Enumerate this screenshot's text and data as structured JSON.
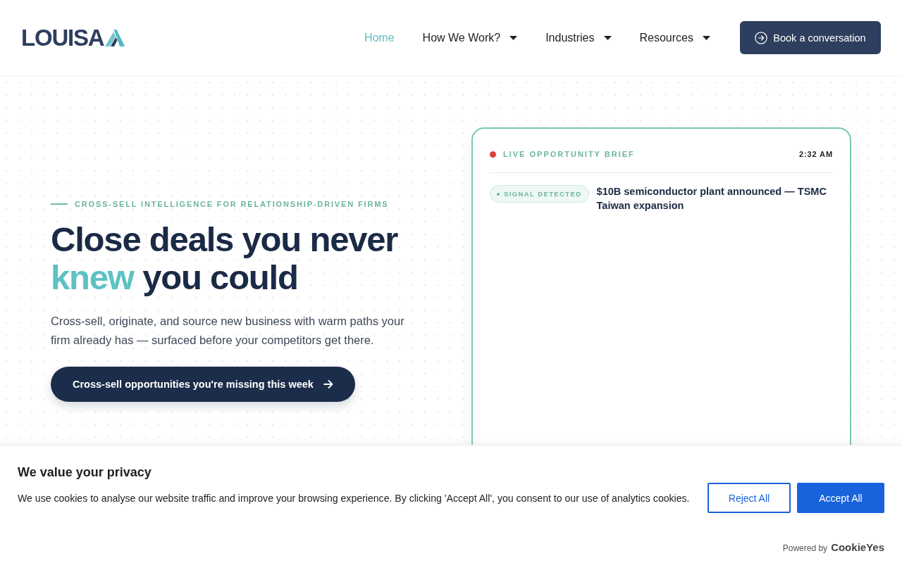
{
  "header": {
    "logo": {
      "text": "LOUISA"
    },
    "nav": [
      {
        "label": "Home",
        "selected": true,
        "dropdown": false
      },
      {
        "label": "How We Work?",
        "selected": false,
        "dropdown": true
      },
      {
        "label": "Industries",
        "selected": false,
        "dropdown": true
      },
      {
        "label": "Resources",
        "selected": false,
        "dropdown": true
      }
    ],
    "cta": {
      "label": "Book a conversation"
    }
  },
  "hero": {
    "eyebrow": "CROSS-SELL INTELLIGENCE FOR RELATIONSHIP-DRIVEN FIRMS",
    "heading": [
      {
        "text": "Close deals you never ",
        "highlight": false
      },
      {
        "text": "knew",
        "highlight": true
      },
      {
        "text": " you could",
        "highlight": false
      }
    ],
    "description": "Cross-sell, originate, and source new business with warm paths your firm already has — surfaced before your competitors get there.",
    "cta": {
      "label": "Cross-sell opportunities you're missing this week"
    }
  },
  "brief_card": {
    "live": true,
    "title": "LIVE OPPORTUNITY BRIEF",
    "time": "2:32 AM",
    "signals": [
      {
        "badge": "SIGNAL DETECTED",
        "headline": "$10B semiconductor plant announced — TSMC Taiwan expansion"
      }
    ]
  },
  "cookie_banner": {
    "title": "We value your privacy",
    "text": "We use cookies to analyse our website traffic and improve your browsing experience. By clicking 'Accept All', you consent to our use of analytics cookies.",
    "buttons": [
      {
        "label": "Reject All",
        "kind": "secondary"
      },
      {
        "label": "Accept All",
        "kind": "primary"
      }
    ],
    "powered_by": "Powered by",
    "brand": "CookieYes"
  }
}
